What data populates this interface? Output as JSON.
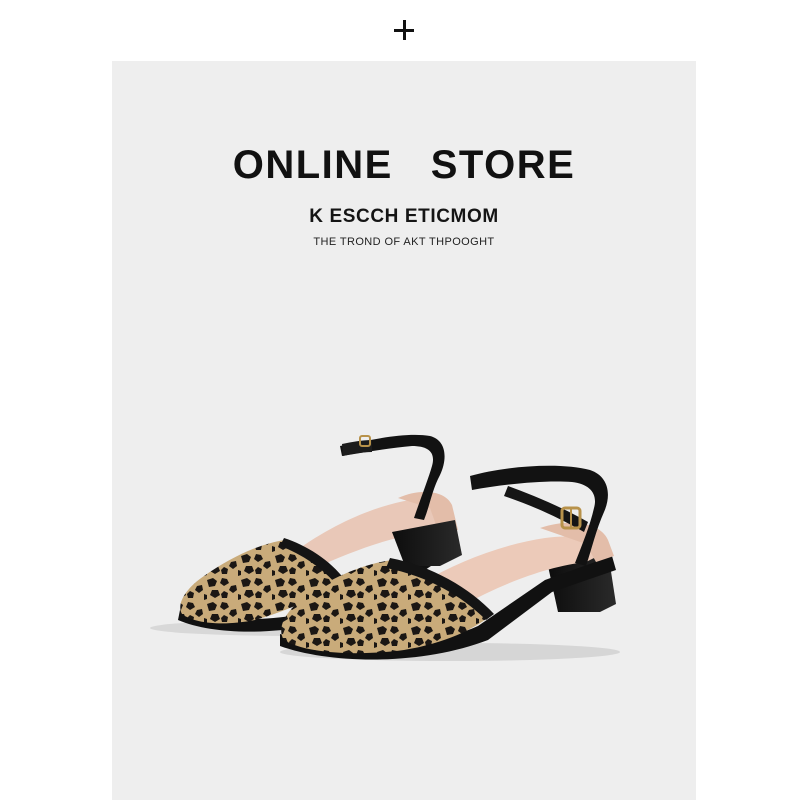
{
  "header": {
    "icon": "plus-icon"
  },
  "banner": {
    "title": "ONLINE   STORE",
    "subtitle": "K ESCCH ETICMOM",
    "tagline": "THE TROND OF AKT THPOOGHT"
  },
  "product": {
    "image": "leopard-print-pointed-toe-slingback-heels",
    "colors": {
      "knit_base": "#c9ab7a",
      "knit_spots": "#1b1714",
      "strap": "#121212",
      "insole": "#e9c8b8",
      "background": "#eeeeee"
    }
  }
}
